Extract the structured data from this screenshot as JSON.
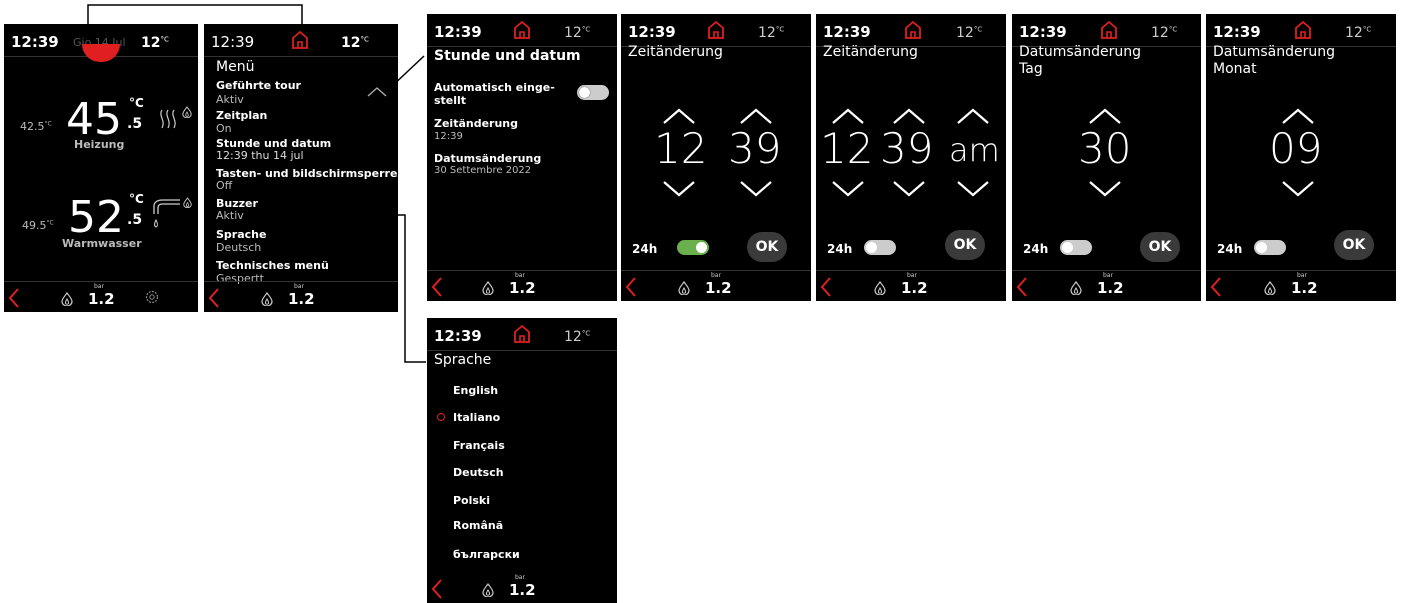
{
  "common": {
    "time": "12:39",
    "outdoor_temp": "12",
    "temp_unit": "°C",
    "bar_label": "bar",
    "pressure": "1.2",
    "accent_color": "#e02020"
  },
  "home": {
    "date": "Gio 14 Jul",
    "heating": {
      "setpoint": "42.5",
      "unit_small": "°C",
      "value": "45",
      "decimal": ".5",
      "unit": "°C",
      "label": "Heizung"
    },
    "dhw": {
      "setpoint": "49.5",
      "unit_small": "°C",
      "value": "52",
      "decimal": ".5",
      "unit": "°C",
      "label": "Warmwasser"
    }
  },
  "menu": {
    "title": "Menü",
    "items": [
      {
        "title": "Geführte tour",
        "value": "Aktiv"
      },
      {
        "title": "Zeitplan",
        "value": "On"
      },
      {
        "title": "Stunde und datum",
        "value": "12:39 thu 14 jul"
      },
      {
        "title": "Tasten- und bildschirmsperre",
        "value": "Off"
      },
      {
        "title": "Buzzer",
        "value": "Aktiv"
      },
      {
        "title": "Sprache",
        "value": "Deutsch"
      },
      {
        "title": "Technisches menü",
        "value": "Gespertt"
      }
    ]
  },
  "datetime": {
    "title": "Stunde und datum",
    "auto_label": "Automatisch einge-",
    "auto_label2": "stellt",
    "auto_enabled": false,
    "time_label": "Zeitänderung",
    "time_value": "12:39",
    "date_label": "Datumsänderung",
    "date_value": "30 Settembre 2022"
  },
  "time24": {
    "title": "Zeitänderung",
    "hour": "12",
    "minute": "39",
    "label_24h": "24h",
    "h24_enabled": true,
    "ok": "OK"
  },
  "time12": {
    "title": "Zeitänderung",
    "hour": "12",
    "minute": "39",
    "ampm": "am",
    "label_24h": "24h",
    "h24_enabled": false,
    "ok": "OK"
  },
  "day": {
    "title": "Datumsänderung",
    "subtitle": "Tag",
    "value": "30",
    "label_24h": "24h",
    "h24_enabled": false,
    "ok": "OK"
  },
  "month": {
    "title": "Datumsänderung",
    "subtitle": "Monat",
    "value": "09",
    "label_24h": "24h",
    "h24_enabled": false,
    "ok": "OK"
  },
  "language": {
    "title": "Sprache",
    "options": [
      "English",
      "Italiano",
      "Français",
      "Deutsch",
      "Polski",
      "Română",
      "български"
    ],
    "selected": "Italiano"
  }
}
